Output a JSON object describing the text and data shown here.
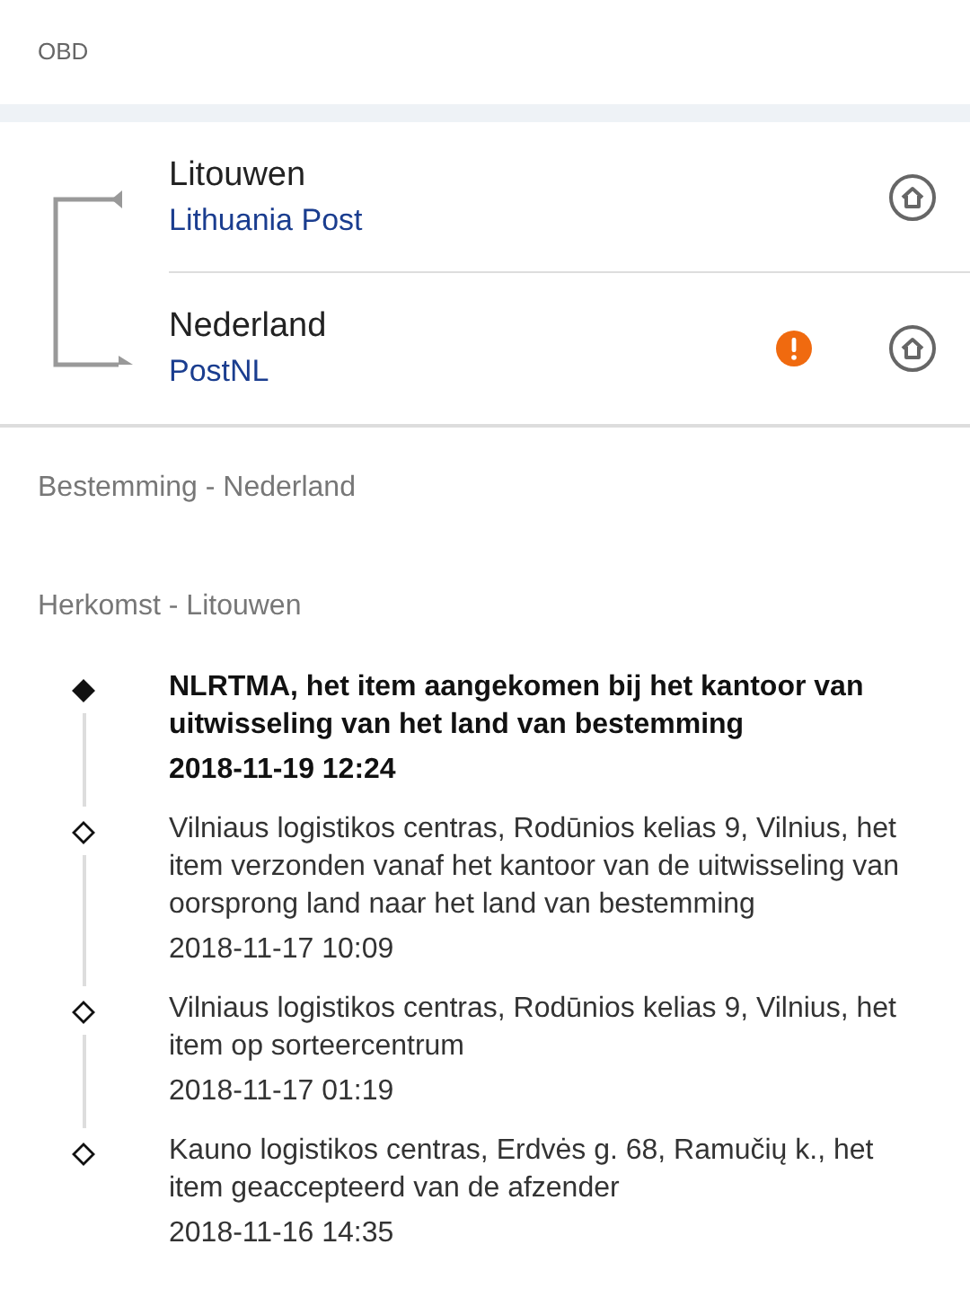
{
  "header": {
    "title": "OBD"
  },
  "route": [
    {
      "country": "Litouwen",
      "carrier": "Lithuania Post",
      "warning": false
    },
    {
      "country": "Nederland",
      "carrier": "PostNL",
      "warning": true
    }
  ],
  "destination_label": "Bestemming - Nederland",
  "origin_label": "Herkomst - Litouwen",
  "events": [
    {
      "text": "NLRTMA, het item aangekomen bij het kantoor van uitwisseling van het land van bestemming",
      "time": "2018-11-19 12:24",
      "latest": true
    },
    {
      "text": "Vilniaus logistikos centras, Rodūnios kelias 9, Vilnius, het item verzonden vanaf het kantoor van de uitwisseling van oorsprong land naar het land van bestemming",
      "time": "2018-11-17 10:09",
      "latest": false
    },
    {
      "text": "Vilniaus logistikos centras, Rodūnios kelias 9, Vilnius, het item op sorteercentrum",
      "time": "2018-11-17 01:19",
      "latest": false
    },
    {
      "text": "Kauno logistikos centras, Erdvės g. 68, Ramučių k., het item geaccepteerd van de afzender",
      "time": "2018-11-16 14:35",
      "latest": false
    }
  ]
}
